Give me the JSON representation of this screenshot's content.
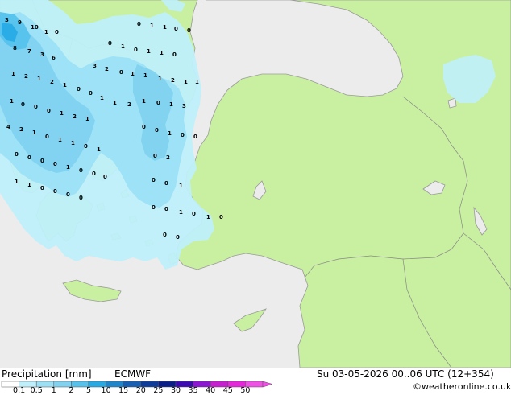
{
  "map": {
    "colors": {
      "sea": "#ececec",
      "land": "#c8f0a0",
      "coast": "#9a9a9a",
      "border": "#888888"
    },
    "precip_labels": [
      "3",
      "9",
      "10",
      "1",
      "0",
      "8",
      "7",
      "3",
      "6",
      "1",
      "2",
      "1",
      "2",
      "1",
      "0",
      "0",
      "1",
      "1",
      "2",
      "3",
      "2",
      "0",
      "1",
      "1",
      "1",
      "2",
      "1",
      "1",
      "0",
      "1",
      "1",
      "0",
      "0",
      "0",
      "1",
      "0",
      "1",
      "1",
      "0",
      "1",
      "0",
      "0",
      "0",
      "1",
      "2",
      "1",
      "1",
      "0",
      "1",
      "3",
      "4",
      "2",
      "1",
      "0",
      "1",
      "1",
      "0",
      "1",
      "0",
      "0",
      "1",
      "0",
      "0",
      "0",
      "0",
      "0",
      "0",
      "1",
      "0",
      "0",
      "0",
      "0",
      "2",
      "0",
      "0",
      "1",
      "1",
      "1",
      "0",
      "0",
      "0",
      "0",
      "0",
      "0",
      "1",
      "0",
      "1",
      "0",
      "0",
      "0"
    ]
  },
  "footer": {
    "title": "Precipitation [mm]",
    "model": "ECMWF",
    "datetime": "Su 03-05-2026 00..06 UTC (12+354)",
    "copyright": "©weatheronline.co.uk",
    "scale_colors": [
      "#ffffff",
      "#bfeffb",
      "#9be0f5",
      "#7fd2f0",
      "#55c2ec",
      "#26aae4",
      "#1e86cc",
      "#1560b4",
      "#0e3c9c",
      "#0a1e8c",
      "#3c0ab4",
      "#8c14d2",
      "#c81ed2",
      "#e628dc",
      "#f050e6"
    ],
    "scale_labels": [
      "0.1",
      "0.5",
      "1",
      "2",
      "5",
      "10",
      "15",
      "20",
      "25",
      "30",
      "35",
      "40",
      "45",
      "50"
    ]
  }
}
